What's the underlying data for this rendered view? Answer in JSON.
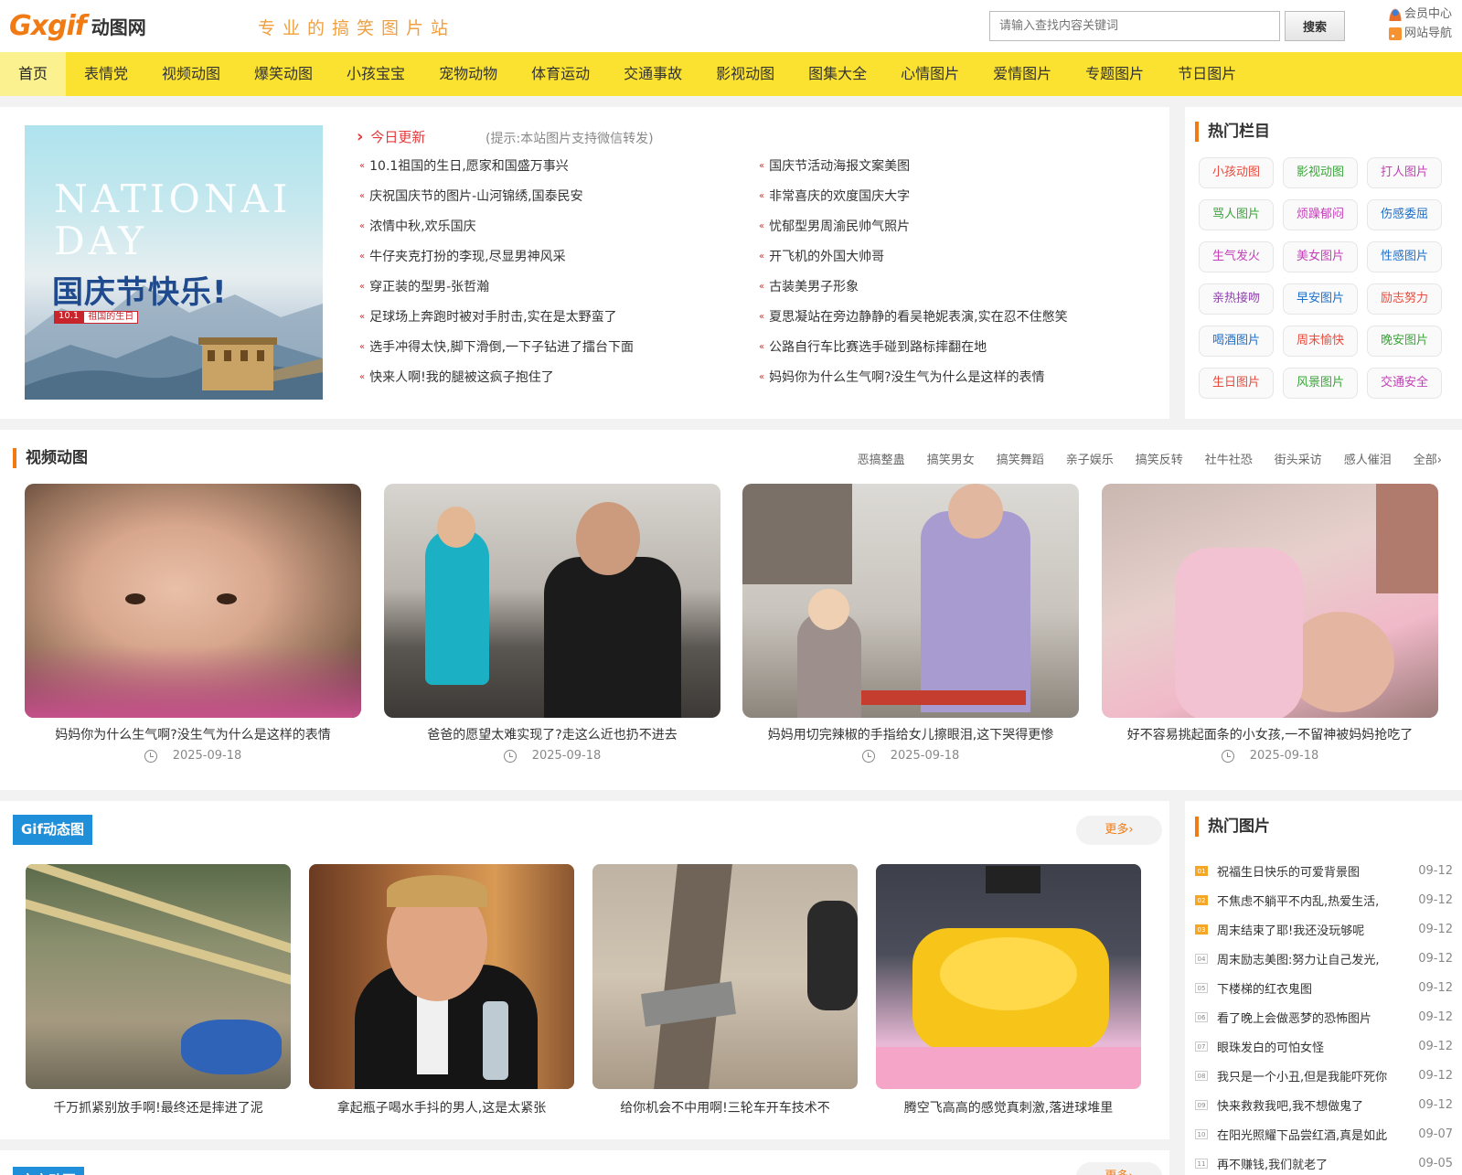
{
  "header": {
    "logo_en": "Gxgif",
    "logo_cn": "动图网",
    "slogan": "专业的搞笑图片站",
    "search_placeholder": "请输入查找内容关键词",
    "search_button": "搜索",
    "member_center": "会员中心",
    "site_nav": "网站导航"
  },
  "nav": {
    "items": [
      "首页",
      "表情党",
      "视频动图",
      "爆笑动图",
      "小孩宝宝",
      "宠物动物",
      "体育运动",
      "交通事故",
      "影视动图",
      "图集大全",
      "心情图片",
      "爱情图片",
      "专题图片",
      "节日图片"
    ]
  },
  "feature": {
    "en_text": "NATIONAI DAY",
    "cn_text": "国庆节快乐!",
    "tag_num": "10.1",
    "tag_text": "祖国的生日"
  },
  "today": {
    "title": "今日更新",
    "tip": "(提示:本站图片支持微信转发)",
    "left": [
      "10.1祖国的生日,愿家和国盛万事兴",
      "庆祝国庆节的图片-山河锦绣,国泰民安",
      "浓情中秋,欢乐国庆",
      "牛仔夹克打扮的李现,尽显男神风采",
      "穿正装的型男-张哲瀚",
      "足球场上奔跑时被对手肘击,实在是太野蛮了",
      "选手冲得太快,脚下滑倒,一下子钻进了擂台下面",
      "快来人啊!我的腿被这疯子抱住了"
    ],
    "right": [
      "国庆节活动海报文案美图",
      "非常喜庆的欢度国庆大字",
      "忧郁型男周渝民帅气照片",
      "开飞机的外国大帅哥",
      "古装美男子形象",
      "夏思凝站在旁边静静的看吴艳妮表演,实在忍不住憋笑",
      "公路自行车比赛选手碰到路标摔翻在地",
      "妈妈你为什么生气啊?没生气为什么是这样的表情"
    ]
  },
  "hot_columns": {
    "title": "热门栏目",
    "items": [
      {
        "label": "小孩动图",
        "color": "#e84a3c"
      },
      {
        "label": "影视动图",
        "color": "#3aa53a"
      },
      {
        "label": "打人图片",
        "color": "#c23fb7"
      },
      {
        "label": "骂人图片",
        "color": "#3aa53a"
      },
      {
        "label": "烦躁郁闷",
        "color": "#c23fb7"
      },
      {
        "label": "伤感委屈",
        "color": "#1e6fc8"
      },
      {
        "label": "生气发火",
        "color": "#c23fb7"
      },
      {
        "label": "美女图片",
        "color": "#c23fb7"
      },
      {
        "label": "性感图片",
        "color": "#1e6fc8"
      },
      {
        "label": "亲热接吻",
        "color": "#8e44ad"
      },
      {
        "label": "早安图片",
        "color": "#1e6fc8"
      },
      {
        "label": "励志努力",
        "color": "#e84a3c"
      },
      {
        "label": "喝酒图片",
        "color": "#1e6fc8"
      },
      {
        "label": "周末愉快",
        "color": "#e84a3c"
      },
      {
        "label": "晚安图片",
        "color": "#3aa53a"
      },
      {
        "label": "生日图片",
        "color": "#e84a3c"
      },
      {
        "label": "风景图片",
        "color": "#3aa53a"
      },
      {
        "label": "交通安全",
        "color": "#c23fb7"
      }
    ]
  },
  "video": {
    "title": "视频动图",
    "subs": [
      "恶搞整蛊",
      "搞笑男女",
      "搞笑舞蹈",
      "亲子娱乐",
      "搞笑反转",
      "社牛社恐",
      "街头采访",
      "感人催泪",
      "全部›"
    ],
    "cards": [
      {
        "title": "妈妈你为什么生气啊?没生气为什么是这样的表情",
        "date": "2025-09-18"
      },
      {
        "title": "爸爸的愿望太难实现了?走这么近也扔不进去",
        "date": "2025-09-18"
      },
      {
        "title": "妈妈用切完辣椒的手指给女儿擦眼泪,这下哭得更惨",
        "date": "2025-09-18"
      },
      {
        "title": "好不容易挑起面条的小女孩,一不留神被妈妈抢吃了",
        "date": "2025-09-18"
      }
    ]
  },
  "gif": {
    "label": "Gif动态图",
    "more": "更多›",
    "cards": [
      {
        "title": "千万抓紧别放手啊!最终还是摔进了泥"
      },
      {
        "title": "拿起瓶子喝水手抖的男人,这是太紧张"
      },
      {
        "title": "给你机会不中用啊!三轮车开车技术不"
      },
      {
        "title": "腾空飞高高的感觉真刺激,落进球堆里"
      }
    ]
  },
  "hot_images": {
    "title": "热门图片",
    "items": [
      {
        "num": "01",
        "title": "祝福生日快乐的可爱背景图",
        "date": "09-12"
      },
      {
        "num": "02",
        "title": "不焦虑不躺平不内乱,热爱生活,",
        "date": "09-12"
      },
      {
        "num": "03",
        "title": "周末结束了耶!我还没玩够呢",
        "date": "09-12"
      },
      {
        "num": "04",
        "title": "周末励志美图:努力让自己发光,",
        "date": "09-12"
      },
      {
        "num": "05",
        "title": "下楼梯的红衣鬼图",
        "date": "09-12"
      },
      {
        "num": "06",
        "title": "看了晚上会做恶梦的恐怖图片",
        "date": "09-12"
      },
      {
        "num": "07",
        "title": "眼珠发白的可怕女怪",
        "date": "09-12"
      },
      {
        "num": "08",
        "title": "我只是一个小丑,但是我能吓死你",
        "date": "09-12"
      },
      {
        "num": "09",
        "title": "快来救救我吧,我不想做鬼了",
        "date": "09-12"
      },
      {
        "num": "10",
        "title": "在阳光照耀下品尝红酒,真是如此",
        "date": "09-07"
      },
      {
        "num": "11",
        "title": "再不赚钱,我们就老了",
        "date": "09-05"
      }
    ]
  },
  "bottom": {
    "label": "宝宝动图",
    "more": "更多›"
  }
}
